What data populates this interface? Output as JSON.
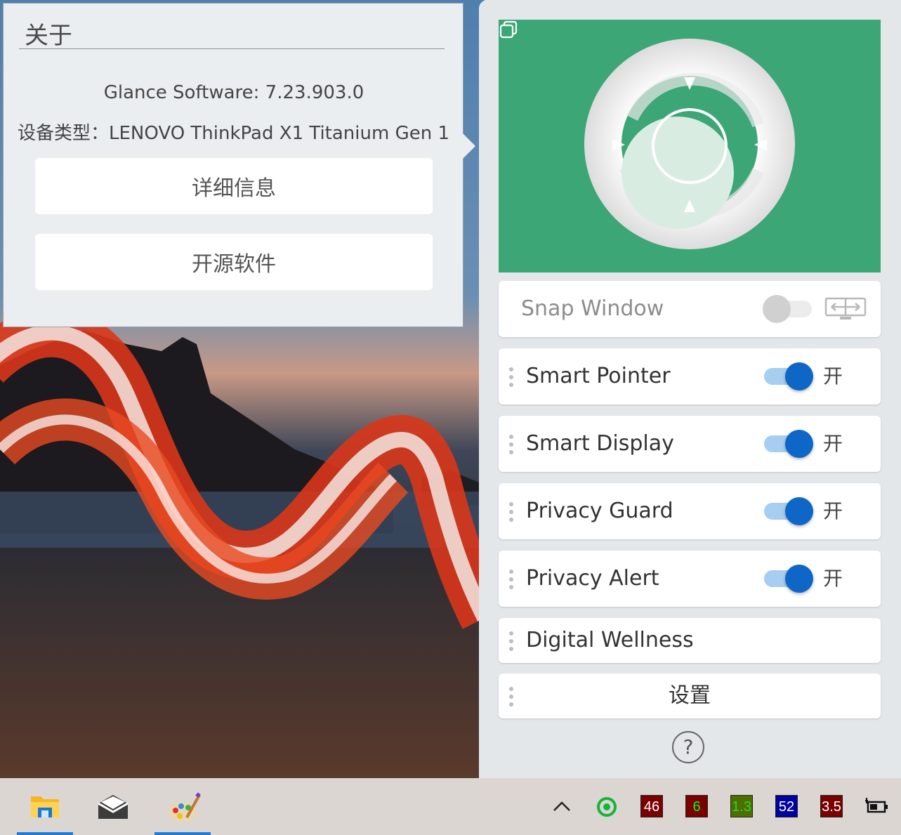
{
  "about": {
    "title": "关于",
    "version": "Glance Software: 7.23.903.0",
    "device": "设备类型：LENOVO ThinkPad X1 Titanium Gen 1",
    "details_button": "详细信息",
    "opensource_button": "开源软件"
  },
  "panel": {
    "hero_bg": "#3da676",
    "snap_window": {
      "label": "Snap Window",
      "on": false
    },
    "features": [
      {
        "label": "Smart Pointer",
        "state": "开",
        "on": true
      },
      {
        "label": "Smart Display",
        "state": "开",
        "on": true
      },
      {
        "label": "Privacy Guard",
        "state": "开",
        "on": true
      },
      {
        "label": "Privacy Alert",
        "state": "开",
        "on": true
      }
    ],
    "digital_wellness": "Digital Wellness",
    "settings": "设置",
    "help": "?"
  },
  "taskbar": {
    "apps": [
      "file-explorer-icon",
      "mail-icon",
      "paint-icon"
    ],
    "tray": {
      "chevron": "^",
      "badges": [
        {
          "text": "46",
          "bg": "#7a0000",
          "fg": "#ffffff"
        },
        {
          "text": "6",
          "bg": "#7a0000",
          "fg": "#00ff00"
        },
        {
          "text": "1.3",
          "bg": "#4e6e00",
          "fg": "#22dd22"
        },
        {
          "text": "52",
          "bg": "#0000a0",
          "fg": "#ffffff"
        },
        {
          "text": "3.5",
          "bg": "#7a0000",
          "fg": "#ffffff"
        }
      ]
    }
  },
  "colors": {
    "accent": "#0e67c6",
    "track": "#a7cdf0"
  }
}
